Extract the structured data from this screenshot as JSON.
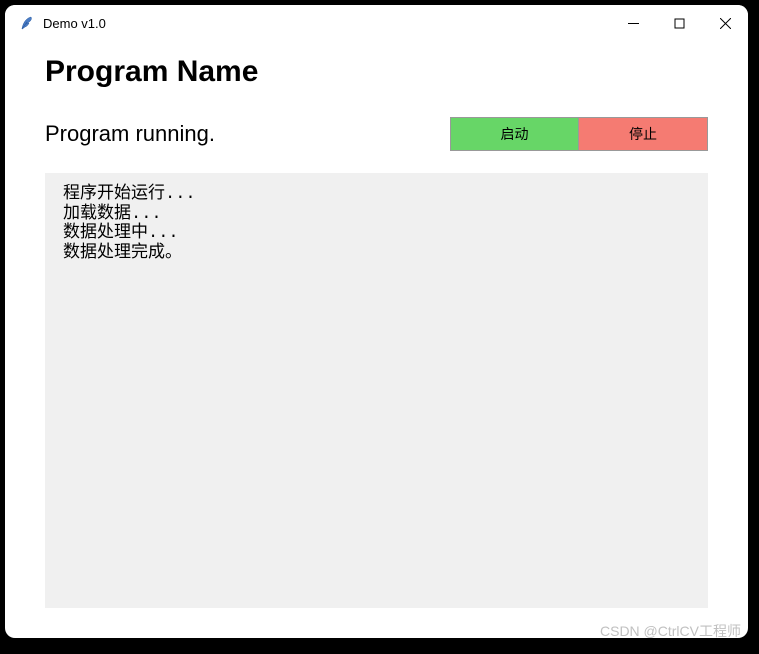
{
  "window": {
    "title": "Demo v1.0",
    "icon": "feather-icon"
  },
  "heading": "Program Name",
  "status_text": "Program running.",
  "buttons": {
    "start_label": "启动",
    "stop_label": "停止"
  },
  "log_lines": [
    "程序开始运行...",
    "加载数据...",
    "数据处理中...",
    "数据处理完成。"
  ],
  "colors": {
    "start_button": "#67d667",
    "stop_button": "#f57b72",
    "log_background": "#f0f0f0"
  },
  "watermark": "CSDN @CtrlCV工程师"
}
